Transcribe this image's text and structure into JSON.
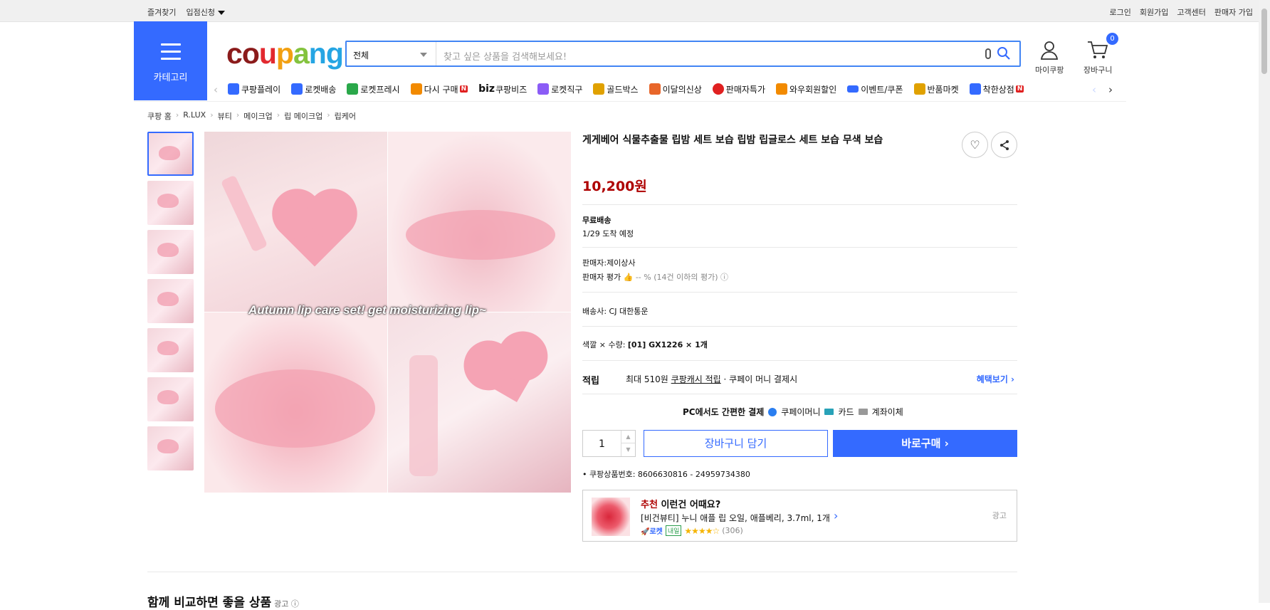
{
  "topbar": {
    "bookmark": "즐겨찾기",
    "seller_apply": "입점신청",
    "links": [
      "로그인",
      "회원가입",
      "고객센터",
      "판매자 가입"
    ]
  },
  "header": {
    "category_label": "카테고리",
    "logo": "coupang",
    "search": {
      "scope": "전체",
      "placeholder": "찾고 싶은 상품을 검색해보세요!"
    },
    "mycoupang": "마이쿠팡",
    "cart": "장바구니",
    "cart_count": "0"
  },
  "nav": [
    {
      "label": "쿠팡플레이",
      "color": "#346aff"
    },
    {
      "label": "로켓배송",
      "color": "#346aff"
    },
    {
      "label": "로켓프레시",
      "color": "#2aa84a"
    },
    {
      "label": "다시 구매",
      "color": "#f28a00",
      "new": "N"
    },
    {
      "label": "쿠팡비즈",
      "color": "#333",
      "prefix": "biz"
    },
    {
      "label": "로켓직구",
      "color": "#8b5cf6"
    },
    {
      "label": "골드박스",
      "color": "#e0a100"
    },
    {
      "label": "이달의신상",
      "color": "#e8662a"
    },
    {
      "label": "판매자특가",
      "color": "#e02020"
    },
    {
      "label": "와우회원할인",
      "color": "#f28a00"
    },
    {
      "label": "이벤트/쿠폰",
      "color": "#346aff"
    },
    {
      "label": "반품마켓",
      "color": "#e0a100"
    },
    {
      "label": "착한상점",
      "color": "#346aff",
      "new": "N"
    }
  ],
  "breadcrumb": [
    "쿠팡 홈",
    "R.LUX",
    "뷰티",
    "메이크업",
    "립 메이크업",
    "립케어"
  ],
  "product": {
    "title": "게게베어 식물추출물 립밤 세트 보습 립밤 립글로스 세트 보습 무색 보습",
    "image_caption": "Autumn lip care set! get moisturizing lip~",
    "price": "10,200원",
    "shipping": "무료배송",
    "arrival": "1/29 도착 예정",
    "seller": "판매자:제이상사",
    "seller_rating_label": "판매자 평가",
    "seller_rating_value": "-- %",
    "seller_rating_note": "(14건 이하의 평가)",
    "carrier": "배송사:  CJ 대한통운",
    "option_label": "색깔 × 수량: ",
    "option_value": "[01] GX1226 × 1개",
    "reward_label": "적립",
    "reward_text1": "최대 510원",
    "reward_link": "쿠팡캐시 적립",
    "reward_text2": " · 쿠페이 머니 결제시",
    "reward_more": "혜택보기 ›",
    "pc_pay": "PC에서도 간편한 결제",
    "pay_methods": [
      "쿠페이머니",
      "카드",
      "계좌이체"
    ],
    "quantity": "1",
    "cart_btn": "장바구니 담기",
    "buy_btn": "바로구매 ›",
    "product_number": "쿠팡상품번호: 8606630816 - 24959734380"
  },
  "recommend": {
    "title_em": "추천",
    "title_rest": " 이런건 어때요?",
    "name": "[비건뷰티] 누니 애플 립 오일, 애플베리, 3.7ml, 1개",
    "rocket": "로켓",
    "badge": "내일",
    "stars": "★★★★☆",
    "reviews": "(306)",
    "ad": "광고"
  },
  "section": {
    "title": "함께 비교하면 좋을 상품",
    "ad": "광고 ⓘ"
  }
}
